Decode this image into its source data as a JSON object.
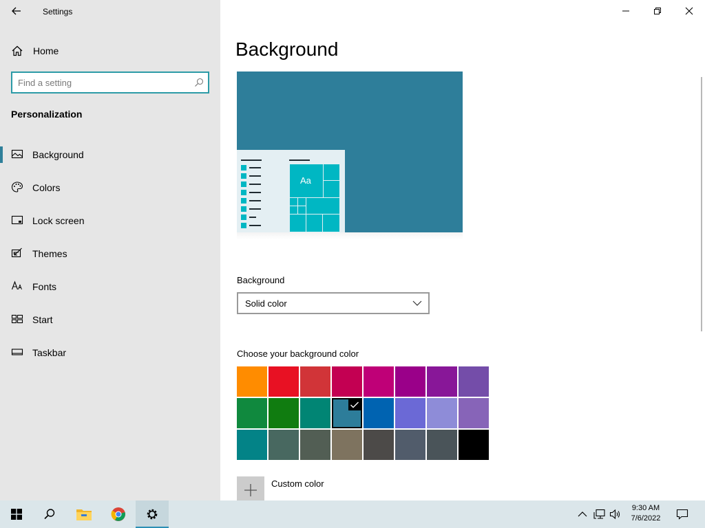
{
  "window": {
    "title": "Settings",
    "controls": {
      "minimize": "minimize",
      "restore": "restore",
      "close": "close"
    }
  },
  "sidebar": {
    "home_label": "Home",
    "search_placeholder": "Find a setting",
    "section_title": "Personalization",
    "items": [
      {
        "label": "Background",
        "icon": "picture-icon",
        "selected": true
      },
      {
        "label": "Colors",
        "icon": "palette-icon",
        "selected": false
      },
      {
        "label": "Lock screen",
        "icon": "lock-screen-icon",
        "selected": false
      },
      {
        "label": "Themes",
        "icon": "themes-icon",
        "selected": false
      },
      {
        "label": "Fonts",
        "icon": "fonts-icon",
        "selected": false
      },
      {
        "label": "Start",
        "icon": "start-layout-icon",
        "selected": false
      },
      {
        "label": "Taskbar",
        "icon": "taskbar-icon",
        "selected": false
      }
    ]
  },
  "main": {
    "title": "Background",
    "preview": {
      "aa_text": "Aa",
      "bg_color": "#2e7e9a",
      "tile_color": "#00b7c3"
    },
    "background_label": "Background",
    "background_value": "Solid color",
    "choose_color_label": "Choose your background color",
    "colors": [
      [
        "#ff8c00",
        "#e81123",
        "#d13438",
        "#c30052",
        "#bf0077",
        "#9a0089",
        "#881798",
        "#744da9"
      ],
      [
        "#10893e",
        "#107c10",
        "#018574",
        "#2d7d9a",
        "#0063b1",
        "#6b69d6",
        "#8e8cd8",
        "#8764b8"
      ],
      [
        "#038387",
        "#486860",
        "#525e54",
        "#7e735f",
        "#4c4a48",
        "#515c6b",
        "#4a5459",
        "#000000"
      ]
    ],
    "selected_color": "#2d7d9a",
    "custom_color_label": "Custom color"
  },
  "taskbar": {
    "apps": [
      "start",
      "search",
      "file-explorer",
      "chrome",
      "settings"
    ],
    "active_app": "settings",
    "clock_time": "9:30 AM",
    "clock_date": "7/6/2022"
  }
}
